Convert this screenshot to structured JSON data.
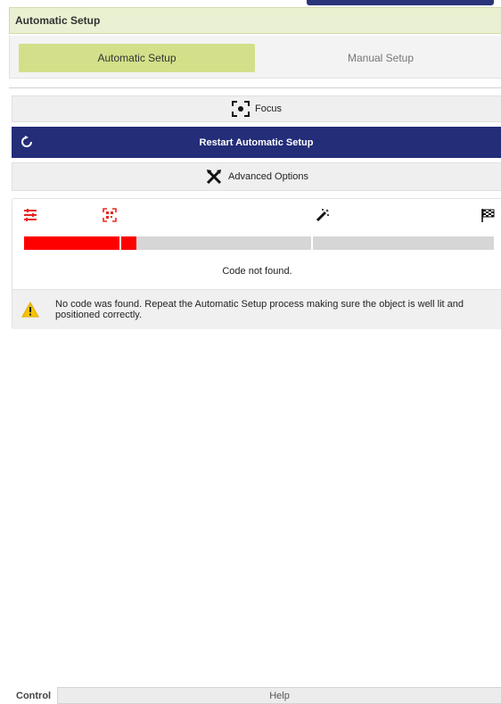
{
  "header": {
    "title": "Automatic Setup"
  },
  "tabs": [
    {
      "label": "Automatic Setup",
      "active": true
    },
    {
      "label": "Manual Setup",
      "active": false
    }
  ],
  "actions": {
    "focus_label": "Focus",
    "restart_label": "Restart Automatic Setup",
    "advanced_label": "Advanced Options"
  },
  "progress": {
    "steps": [
      {
        "icon": "sliders-icon",
        "state": "error"
      },
      {
        "icon": "qr-scan-icon",
        "state": "error"
      },
      {
        "icon": "magic-wand-icon",
        "state": "pending"
      },
      {
        "icon": "checkered-flag-icon",
        "state": "pending"
      }
    ],
    "fill_fraction": 0.24,
    "status_text": "Code not found."
  },
  "warning": {
    "icon": "warning-icon",
    "text": "No code was found. Repeat the Automatic Setup process making sure the object is well lit and positioned correctly."
  },
  "footer": {
    "label": "Control",
    "help_label": "Help"
  },
  "colors": {
    "accent": "#d3e089",
    "header_bg": "#e9f1d2",
    "primary_button": "#232d78",
    "error": "#ff0000",
    "warning": "#f5c400"
  }
}
